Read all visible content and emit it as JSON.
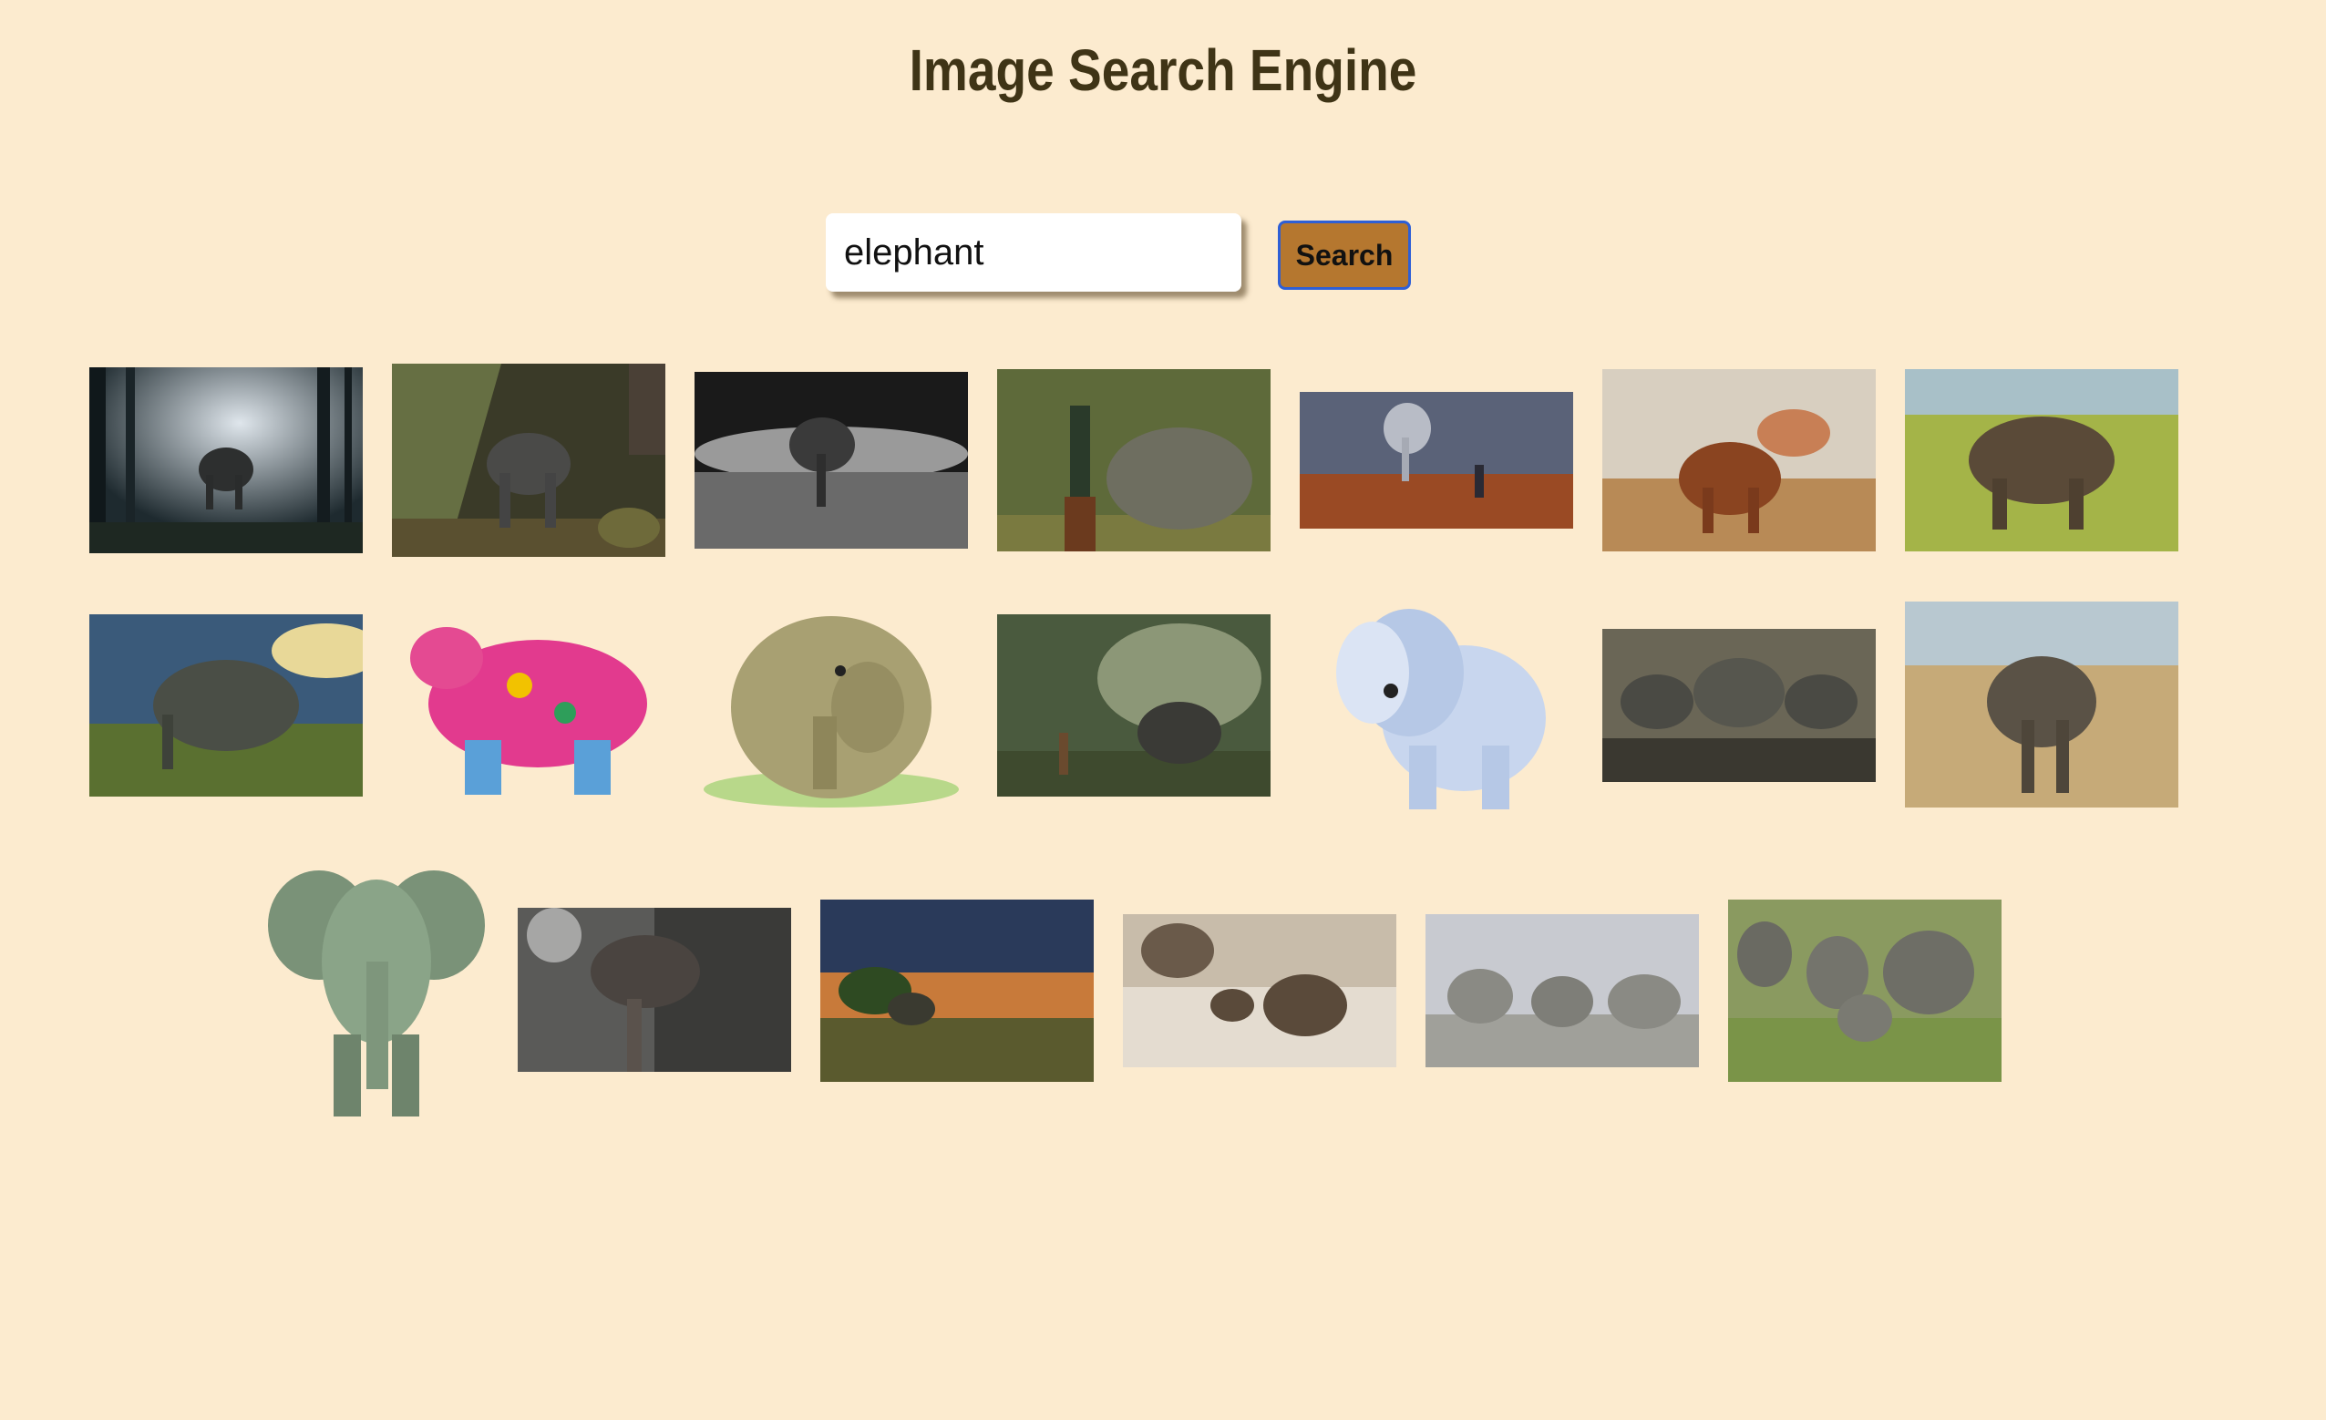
{
  "header": {
    "title": "Image Search Engine"
  },
  "search": {
    "value": "elephant",
    "button_label": "Search"
  },
  "results": {
    "row1": [
      {
        "name": "result-elephant-forest-light"
      },
      {
        "name": "result-baby-elephant-mother"
      },
      {
        "name": "result-elephant-black-white"
      },
      {
        "name": "result-woman-with-elephant"
      },
      {
        "name": "result-giant-elephant-man"
      },
      {
        "name": "result-elephant-dust-bath"
      },
      {
        "name": "result-elephant-grassland"
      }
    ],
    "row2": [
      {
        "name": "result-elephant-savanna-sky"
      },
      {
        "name": "result-decorated-pink-elephant"
      },
      {
        "name": "result-cartoon-elephant-green"
      },
      {
        "name": "result-boy-feeding-elephant"
      },
      {
        "name": "result-cartoon-baby-elephant"
      },
      {
        "name": "result-elephant-herd-dark"
      },
      {
        "name": "result-elephant-dry-bush"
      }
    ],
    "row3": [
      {
        "name": "result-illustrated-elephant"
      },
      {
        "name": "result-elephant-splash"
      },
      {
        "name": "result-elephant-sunset"
      },
      {
        "name": "result-elephants-river"
      },
      {
        "name": "result-elephants-walking"
      },
      {
        "name": "result-elephant-family-grass"
      }
    ]
  }
}
